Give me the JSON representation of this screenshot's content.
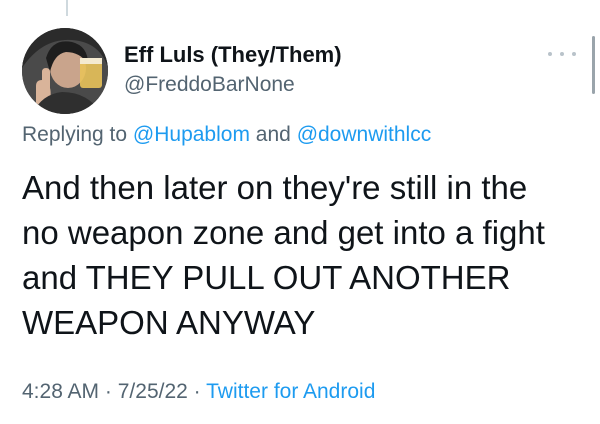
{
  "author": {
    "display_name": "Eff Luls (They/Them)",
    "handle": "@FreddoBarNone"
  },
  "reply": {
    "prefix": "Replying to",
    "mention_1": "@Hupablom",
    "conjunction": "and",
    "mention_2": "@downwithlcc"
  },
  "tweet": {
    "text": "And then later on they're still in the\nno weapon zone and get into a fight\nand THEY PULL OUT ANOTHER\nWEAPON ANYWAY"
  },
  "meta": {
    "time": "4:28 AM",
    "separator_1": "·",
    "date": "7/25/22",
    "separator_2": "·",
    "client": "Twitter for Android"
  },
  "icons": {
    "more": "more-horizontal-icon"
  },
  "colors": {
    "link": "#1d9bf0",
    "secondary_text": "#536471",
    "primary_text": "#0f1419"
  }
}
